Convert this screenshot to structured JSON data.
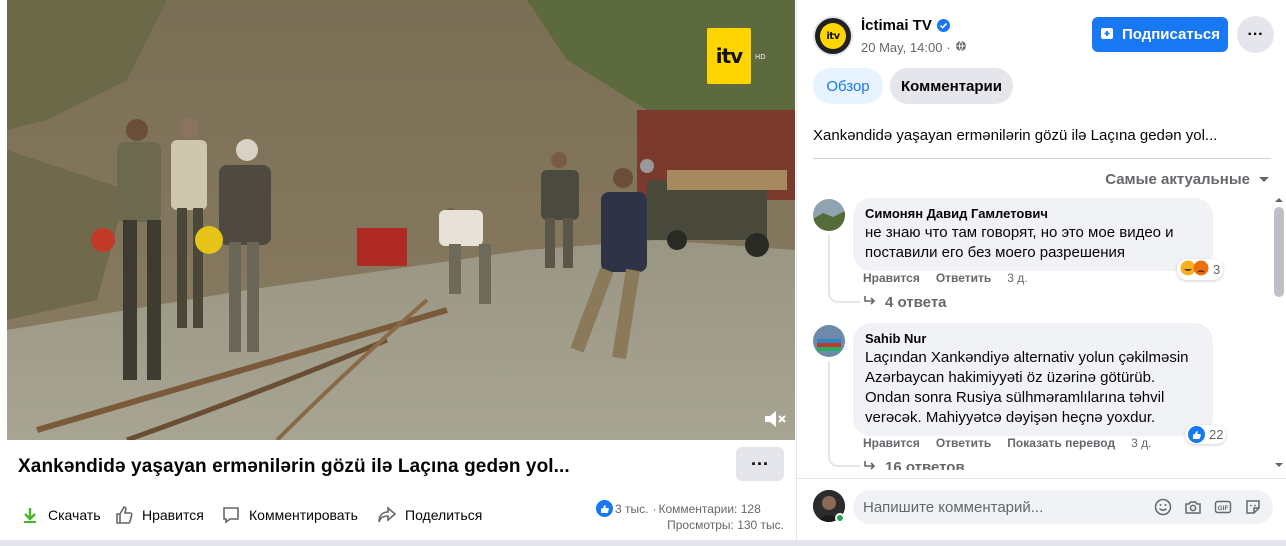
{
  "video": {
    "title": "Xankəndidə yaşayan ermənilərin gözü ilə Laçına gedən yol...",
    "channel_logo_text": "itv",
    "channel_logo_suffix": "HD"
  },
  "actions": {
    "download": "Скачать",
    "like": "Нравится",
    "comment": "Комментировать",
    "share": "Поделиться"
  },
  "stats": {
    "reactions": "3 тыс.",
    "comments": "Комментарии: 128",
    "separator": "·",
    "views": "Просмотры: 130 тыс."
  },
  "post": {
    "page_name": "İctimai TV",
    "avatar_text": "itv",
    "date": "20 May, 14:00",
    "date_separator": "·",
    "subscribe_label": "Подписаться",
    "more_label": "···",
    "text": "Xankəndidə yaşayan ermənilərin gözü ilə Laçına gedən yol..."
  },
  "tabs": [
    {
      "label": "Обзор",
      "active": true
    },
    {
      "label": "Комментарии",
      "active": false
    }
  ],
  "sort_label": "Самые актуальные",
  "comments": [
    {
      "author": "Симонян Давид Гамлетович",
      "text": "не знаю что там говорят, но это мое видео и поставили его без моего разрешения",
      "like_label": "Нравится",
      "reply_label": "Ответить",
      "time": "3 д.",
      "reaction_count": "3",
      "replies_label": "4 ответа"
    },
    {
      "author": "Sahib Nur",
      "text": "Laçından Xankəndiyə alternativ yolun çəkilməsin Azərbaycan hakimiyyəti öz üzərinə götürüb. Ondan sonra Rusiya sülhməramlılarına təhvil verəcək. Mahiyyətcə dəyişən heçnə yoxdur.",
      "like_label": "Нравится",
      "reply_label": "Ответить",
      "translate_label": "Показать перевод",
      "time": "3 д.",
      "reaction_count": "22",
      "replies_label": "16 ответов"
    }
  ],
  "composer": {
    "placeholder": "Напишите комментарий..."
  },
  "colors": {
    "accent": "#1877f2",
    "logo_yellow": "#ffd500",
    "online": "#31a24c"
  }
}
